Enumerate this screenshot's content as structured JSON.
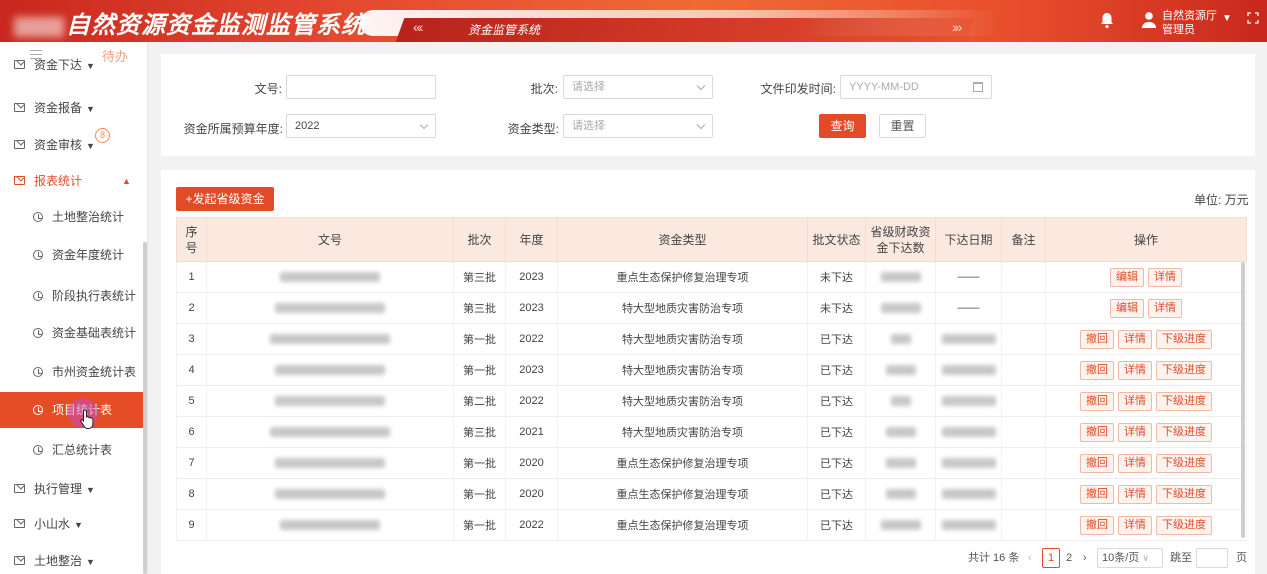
{
  "header": {
    "system_title": "自然资源资金监测监管系统",
    "subtitle": "资金监管系统",
    "nav_prev": "«‹",
    "nav_next": "›»",
    "user_org": "自然资源厅",
    "user_role": "管理员"
  },
  "sidebar": {
    "todo": "待办",
    "menus": [
      {
        "label": "资金下达"
      },
      {
        "label": "资金报备"
      },
      {
        "label": "资金审核",
        "badge": "8"
      },
      {
        "label": "报表统计"
      }
    ],
    "submenus": [
      {
        "label": "土地整治统计"
      },
      {
        "label": "资金年度统计"
      },
      {
        "label": "阶段执行表统计"
      },
      {
        "label": "资金基础表统计"
      },
      {
        "label": "市州资金统计表"
      },
      {
        "label": "项目统计表"
      },
      {
        "label": "汇总统计表"
      }
    ],
    "bottom_menus": [
      {
        "label": "执行管理"
      },
      {
        "label": "小山水"
      },
      {
        "label": "土地整治"
      }
    ]
  },
  "filters": {
    "doc_no": {
      "label": "文号:",
      "value": ""
    },
    "batch": {
      "label": "批次:",
      "placeholder": "请选择"
    },
    "issue_time": {
      "label": "文件印发时间:",
      "placeholder": "YYYY-MM-DD"
    },
    "budget_year": {
      "label": "资金所属预算年度:",
      "value": "2022"
    },
    "fund_type": {
      "label": "资金类型:",
      "placeholder": "请选择"
    },
    "query_label": "查询",
    "reset_label": "重置"
  },
  "toolbar": {
    "add_label": "+发起省级资金",
    "unit_label": "单位: 万元"
  },
  "table": {
    "headers": [
      "序号",
      "文号",
      "批次",
      "年度",
      "资金类型",
      "批文状态",
      "省级财政资金下达数",
      "下达日期",
      "备注",
      "操作"
    ],
    "header_seq": [
      "序",
      "号"
    ],
    "header_amount": [
      "省级财政资",
      "金下达数"
    ],
    "rows": [
      {
        "seq": "1",
        "batch": "第三批",
        "year": "2023",
        "type": "重点生态保护修复治理专项",
        "status": "未下达",
        "date": "——",
        "ops": [
          "编辑",
          "详情"
        ]
      },
      {
        "seq": "2",
        "batch": "第三批",
        "year": "2023",
        "type": "特大型地质灾害防治专项",
        "status": "未下达",
        "date": "——",
        "ops": [
          "编辑",
          "详情"
        ]
      },
      {
        "seq": "3",
        "batch": "第一批",
        "year": "2022",
        "type": "特大型地质灾害防治专项",
        "status": "已下达",
        "date": "",
        "ops": [
          "撤回",
          "详情",
          "下级进度"
        ]
      },
      {
        "seq": "4",
        "batch": "第一批",
        "year": "2023",
        "type": "特大型地质灾害防治专项",
        "status": "已下达",
        "date": "",
        "ops": [
          "撤回",
          "详情",
          "下级进度"
        ]
      },
      {
        "seq": "5",
        "batch": "第二批",
        "year": "2022",
        "type": "特大型地质灾害防治专项",
        "status": "已下达",
        "date": "",
        "ops": [
          "撤回",
          "详情",
          "下级进度"
        ]
      },
      {
        "seq": "6",
        "batch": "第三批",
        "year": "2021",
        "type": "特大型地质灾害防治专项",
        "status": "已下达",
        "date": "",
        "ops": [
          "撤回",
          "详情",
          "下级进度"
        ]
      },
      {
        "seq": "7",
        "batch": "第一批",
        "year": "2020",
        "type": "重点生态保护修复治理专项",
        "status": "已下达",
        "date": "",
        "ops": [
          "撤回",
          "详情",
          "下级进度"
        ]
      },
      {
        "seq": "8",
        "batch": "第一批",
        "year": "2020",
        "type": "重点生态保护修复治理专项",
        "status": "已下达",
        "date": "",
        "ops": [
          "撤回",
          "详情",
          "下级进度"
        ]
      },
      {
        "seq": "9",
        "batch": "第一批",
        "year": "2022",
        "type": "重点生态保护修复治理专项",
        "status": "已下达",
        "date": "",
        "ops": [
          "撤回",
          "详情",
          "下级进度"
        ]
      }
    ]
  },
  "pagination": {
    "total": "共计 16 条",
    "pages": [
      "1",
      "2"
    ],
    "current": "1",
    "page_size": "10条/页",
    "goto_label": "跳至",
    "page_suffix": "页"
  },
  "colors": {
    "accent": "#e34b28",
    "header_bg": "#fbe9e0"
  }
}
